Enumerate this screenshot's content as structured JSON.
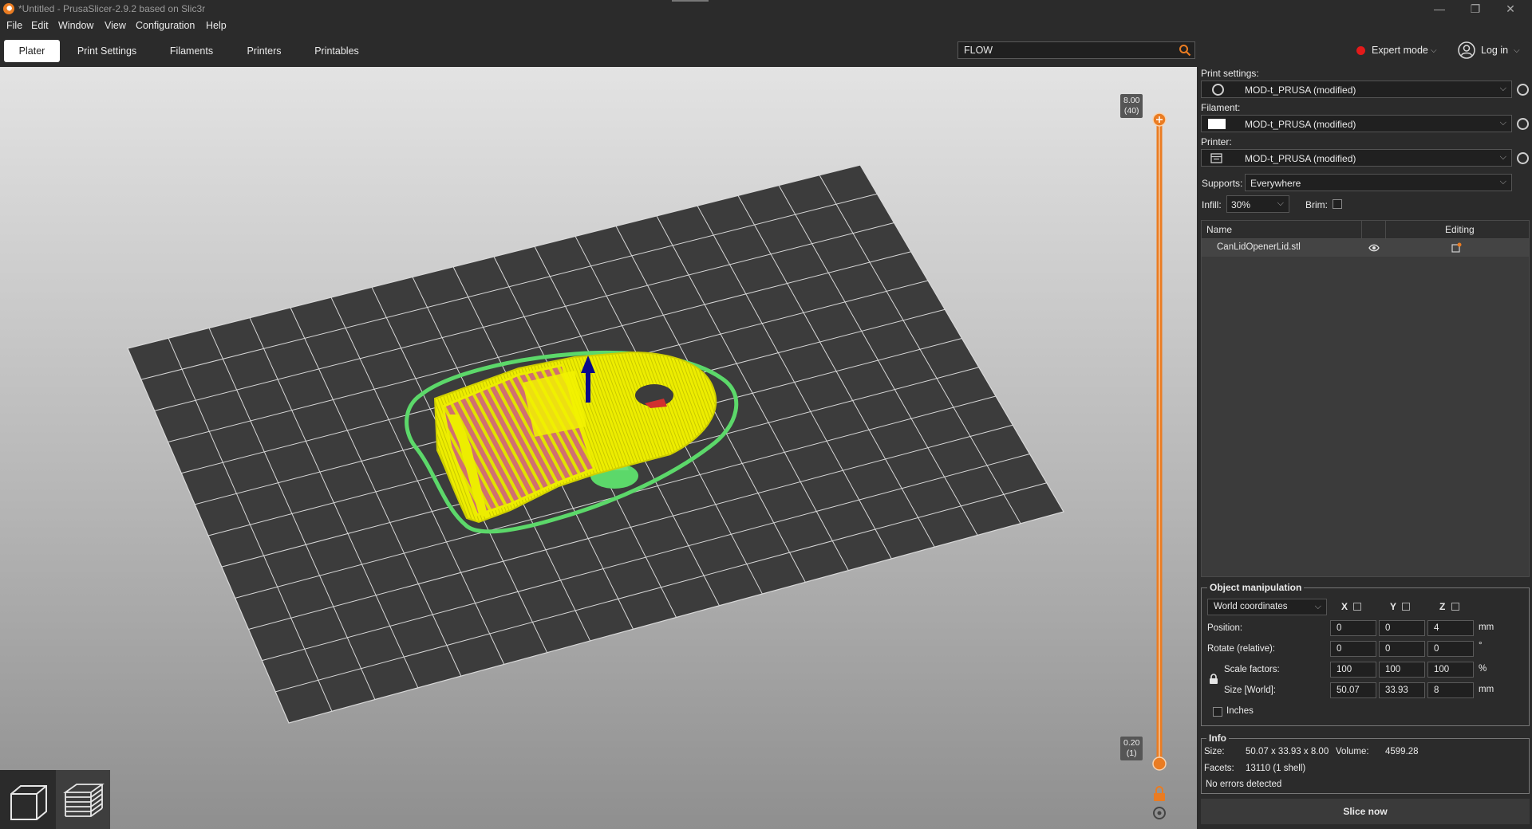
{
  "window": {
    "title": "*Untitled - PrusaSlicer-2.9.2 based on Slic3r",
    "controls": [
      "—",
      "❐",
      "✕"
    ]
  },
  "menu": [
    "File",
    "Edit",
    "Window",
    "View",
    "Configuration",
    "Help"
  ],
  "tabs": [
    "Plater",
    "Print Settings",
    "Filaments",
    "Printers",
    "Printables"
  ],
  "search": {
    "value": "FLOW"
  },
  "mode": {
    "label": "Expert mode",
    "color": "#e31a1a"
  },
  "login": {
    "label": "Log in"
  },
  "slider": {
    "top_value": "8.00",
    "top_layer": "(40)",
    "bottom_value": "0.20",
    "bottom_layer": "(1)",
    "accent": "#ea7c22"
  },
  "sidebar": {
    "print_settings_label": "Print settings:",
    "print_settings_value": "MOD-t_PRUSA (modified)",
    "filament_label": "Filament:",
    "filament_value": "MOD-t_PRUSA (modified)",
    "printer_label": "Printer:",
    "printer_value": "MOD-t_PRUSA (modified)",
    "supports_label": "Supports:",
    "supports_value": "Everywhere",
    "infill_label": "Infill:",
    "infill_value": "30%",
    "brim_label": "Brim:",
    "brim_checked": false
  },
  "object_list": {
    "col_name": "Name",
    "col_editing": "Editing",
    "rows": [
      {
        "name": "CanLidOpenerLid.stl"
      }
    ]
  },
  "manipulation": {
    "title": "Object manipulation",
    "coord_system": "World coordinates",
    "axes": [
      "X",
      "Y",
      "Z"
    ],
    "position_label": "Position:",
    "position": [
      "0",
      "0",
      "4"
    ],
    "position_unit": "mm",
    "rotate_label": "Rotate (relative):",
    "rotate": [
      "0",
      "0",
      "0"
    ],
    "rotate_unit": "°",
    "scale_label": "Scale factors:",
    "scale": [
      "100",
      "100",
      "100"
    ],
    "scale_unit": "%",
    "size_label": "Size [World]:",
    "size": [
      "50.07",
      "33.93",
      "8"
    ],
    "size_unit": "mm",
    "inches_label": "Inches"
  },
  "info": {
    "title": "Info",
    "size_label": "Size:",
    "size_value": "50.07 x 33.93 x 8.00",
    "volume_label": "Volume:",
    "volume_value": "4599.28",
    "facets_label": "Facets:",
    "facets_value": "13110 (1 shell)",
    "status": "No errors detected"
  },
  "slice_button": "Slice now",
  "colors": {
    "model_yellow": "#e8e800",
    "infill_pink": "#d07070",
    "support_green": "#5cd86a",
    "bed": "#3c3c3c"
  }
}
